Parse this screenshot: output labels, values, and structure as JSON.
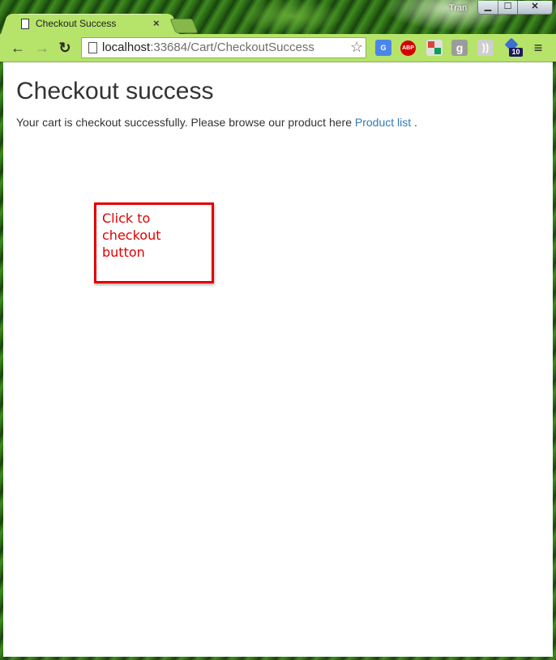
{
  "window": {
    "user_badge": "Tran",
    "controls": {
      "minimize": "▁",
      "maximize": "☐",
      "close": "✕"
    }
  },
  "tab": {
    "title": "Checkout Success",
    "close_glyph": "×",
    "icon": "page-icon"
  },
  "toolbar": {
    "back_glyph": "←",
    "forward_glyph": "→",
    "reload_glyph": "↻",
    "url_host": "localhost",
    "url_rest": ":33684/Cart/CheckoutSuccess",
    "star_glyph": "☆",
    "extensions": {
      "translate": "G",
      "abp": "ABP",
      "google": "g",
      "rss": "))",
      "badge_count": "10"
    },
    "menu_glyph": "≡"
  },
  "page": {
    "title": "Checkout success",
    "message_prefix": "Your cart is checkout successfully. Please browse our product here ",
    "link_text": "Product list",
    "message_suffix": " ."
  },
  "annotation": {
    "text": "Click to checkout button",
    "color": "#e00000"
  }
}
